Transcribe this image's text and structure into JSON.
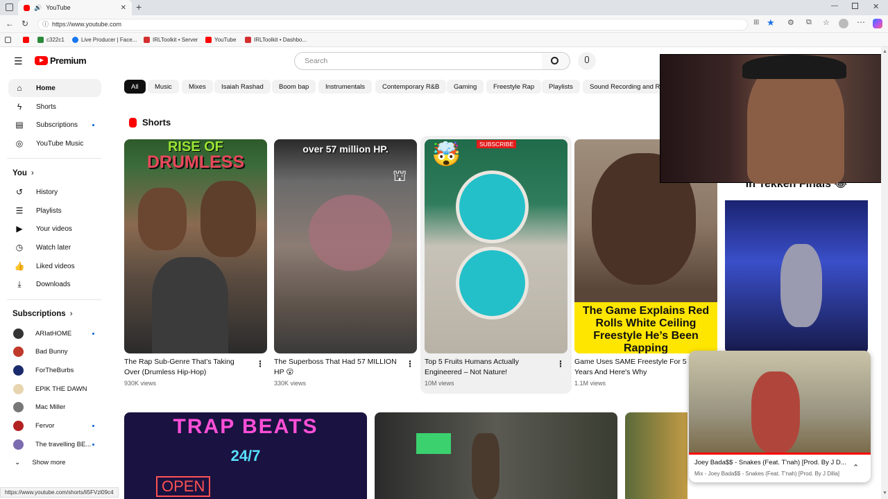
{
  "browser": {
    "tab_title": "YouTube",
    "url": "https://www.youtube.com",
    "bookmarks": [
      "c322c1",
      "Live Producer | Face...",
      "IRLToolkit • Server",
      "YouTube",
      "IRLToolkit • Dashbo..."
    ],
    "status_url": "https://www.youtube.com/shorts/li5FVzl09c4"
  },
  "header": {
    "logo_text": "Premium",
    "search_placeholder": "Search"
  },
  "chips": [
    "All",
    "Music",
    "Mixes",
    "Isaiah Rashad",
    "Boom bap",
    "Instrumentals",
    "Contemporary R&B",
    "Gaming",
    "Freestyle Rap",
    "Playlists",
    "Sound Recording and Re"
  ],
  "sidebar": {
    "main": [
      "Home",
      "Shorts",
      "Subscriptions",
      "YouTube Music"
    ],
    "you_heading": "You",
    "you": [
      "History",
      "Playlists",
      "Your videos",
      "Watch later",
      "Liked videos",
      "Downloads"
    ],
    "subs_heading": "Subscriptions",
    "subs": [
      "ARIatHOME",
      "Bad Bunny",
      "ForTheBurbs",
      "EPIK THE DAWN",
      "Mac Miller",
      "Fervor",
      "The travelling BE..."
    ],
    "show_more": "Show more"
  },
  "shorts": {
    "heading": "Shorts",
    "items": [
      {
        "title": "The Rap Sub-Genre That’s Taking Over (Drumless Hip-Hop)",
        "views": "930K views",
        "overlay1": "RISE OF",
        "overlay2": "DRUMLESS"
      },
      {
        "title": "The Superboss That Had 57 MILLION HP 😮",
        "views": "330K views",
        "overlay1": "over 57 million HP."
      },
      {
        "title": "Top 5 Fruits Humans Actually Engineered – Not Nature!",
        "views": "10M views",
        "overlay1": "SUBSCRIBE"
      },
      {
        "title": "Game Uses SAME Freestyle For 5 Years And Here's Why",
        "views": "1.1M views",
        "overlay1": "The Game Explains Red Rolls White Ceiling Freestyle He’s Been Rapping"
      },
      {
        "overlay1": "in Tekken Finals 😂"
      }
    ]
  },
  "videos": {
    "v1_text1": "TRAP BEATS",
    "v1_text2": "24/7",
    "v1_text3": "OPEN"
  },
  "miniplayer": {
    "title": "Joey Bada$$ - Snakes (Feat. T'nah) [Prod. By J D...",
    "subtitle": "Mix - Joey Bada$$ - Snakes (Feat. T'nah) [Prod. By J Dilla]"
  },
  "colors": {
    "yt_red": "#ff0000",
    "accent_blue": "#065fd4"
  }
}
